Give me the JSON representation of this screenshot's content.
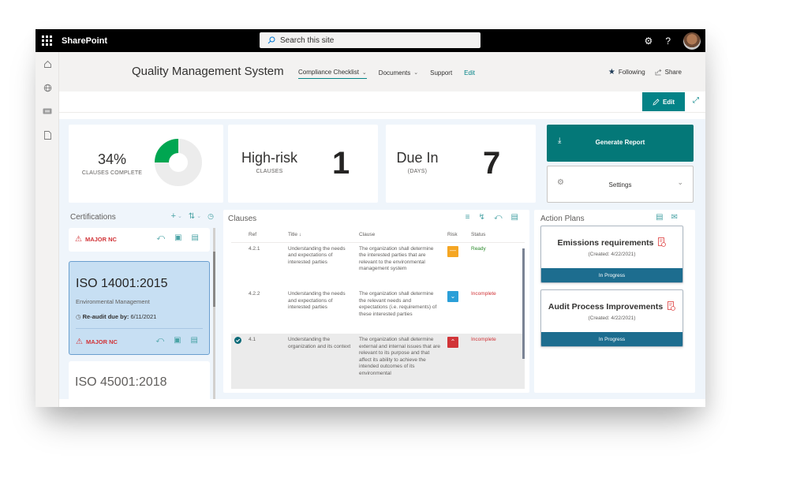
{
  "suitebar": {
    "app_name": "SharePoint",
    "search_placeholder": "Search this site",
    "help_label": "?"
  },
  "site": {
    "title": "Quality Management System",
    "nav": [
      {
        "label": "Compliance Checklist",
        "has_dropdown": true,
        "active": true
      },
      {
        "label": "Documents",
        "has_dropdown": true
      },
      {
        "label": "Support"
      },
      {
        "label": "Edit"
      }
    ],
    "following_label": "Following",
    "share_label": "Share"
  },
  "commandbar": {
    "edit_label": "Edit"
  },
  "stats": {
    "completion": {
      "value": "34%",
      "label": "CLAUSES COMPLETE",
      "percent": 25
    },
    "high_risk": {
      "title": "High-risk",
      "label": "CLAUSES",
      "value": "1"
    },
    "due_in": {
      "title": "Due In",
      "label": "(DAYS)",
      "value": "7"
    }
  },
  "actions": {
    "generate_report": "Generate Report",
    "settings": "Settings"
  },
  "certifications": {
    "title": "Certifications",
    "items": [
      {
        "badge": "MAJOR NC"
      },
      {
        "title": "ISO 14001:2015",
        "subtitle": "Environmental Management",
        "reaudit_label": "Re-audit due by:",
        "reaudit_date": "6/11/2021",
        "badge": "MAJOR NC",
        "selected": true
      },
      {
        "title": "ISO 45001:2018"
      }
    ]
  },
  "clauses": {
    "title": "Clauses",
    "columns": [
      "Ref",
      "Title ↓",
      "Clause",
      "Risk",
      "Status"
    ],
    "rows": [
      {
        "ref": "4.2.1",
        "title": "Understanding the needs and expectations of interested parties",
        "clause": "The organization shall determine the interested parties that are relevant to the environmental management system",
        "risk": "medium",
        "status": "Ready",
        "selected": false
      },
      {
        "ref": "4.2.2",
        "title": "Understanding the needs and expectations of interested parties",
        "clause": "The organization shall determine the relevant needs and expectations (i.e. requirements) of these interested parties",
        "risk": "low",
        "status": "Incomplete",
        "selected": false
      },
      {
        "ref": "4.1",
        "title": "Understanding the organization and its context",
        "clause": "The organization shall determine external and internal issues that are relevant to its purpose and that affect its ability to achieve the intended outcomes of its environmental",
        "risk": "high",
        "status": "Incomplete",
        "selected": true
      }
    ]
  },
  "action_plans": {
    "title": "Action Plans",
    "items": [
      {
        "title": "Emissions requirements",
        "created": "(Created: 4/22/2021)",
        "status": "In Progress"
      },
      {
        "title": "Audit Process Improvements",
        "created": "(Created: 4/22/2021)",
        "status": "In Progress"
      }
    ]
  },
  "colors": {
    "accent": "#038387",
    "donut_fill": "#00a651",
    "donut_track": "#ececec",
    "risk_medium": "#f5a623",
    "risk_low": "#2b9fd8",
    "risk_high": "#d13438",
    "status_ready": "#2e8b2e",
    "status_incomplete": "#d13438",
    "plan_status_bg": "#1d6d8f"
  }
}
